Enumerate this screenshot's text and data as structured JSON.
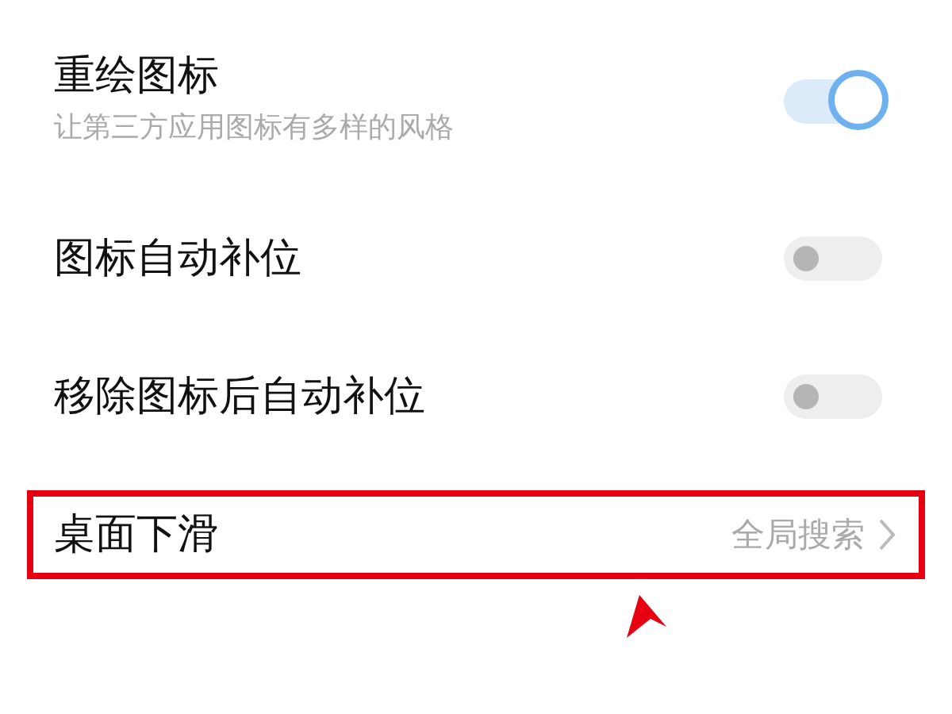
{
  "settings": [
    {
      "kind": "switch",
      "title": "重绘图标",
      "subtitle": "让第三方应用图标有多样的风格",
      "on": true
    },
    {
      "kind": "switch",
      "title": "图标自动补位",
      "on": false
    },
    {
      "kind": "switch",
      "title": "移除图标后自动补位",
      "on": false
    },
    {
      "kind": "link",
      "title": "桌面下滑",
      "value": "全局搜索",
      "highlighted": true
    }
  ]
}
